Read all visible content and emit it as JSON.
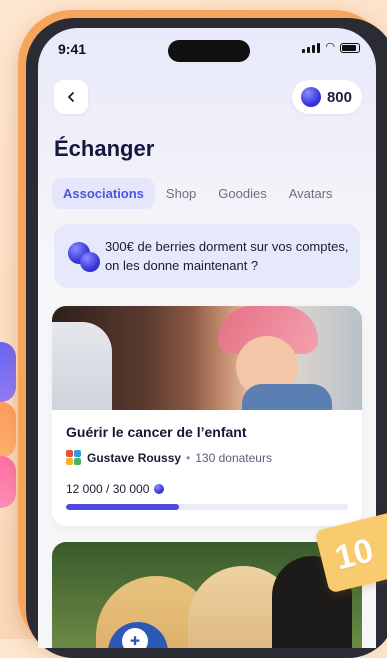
{
  "status_bar": {
    "time": "9:41"
  },
  "header": {
    "title": "Échanger",
    "coins": "800"
  },
  "tabs": [
    {
      "label": "Associations",
      "active": true
    },
    {
      "label": "Shop",
      "active": false
    },
    {
      "label": "Goodies",
      "active": false
    },
    {
      "label": "Avatars",
      "active": false
    }
  ],
  "banner": {
    "text": "300€ de berries dorment sur vos comptes, on les donne maintenant ?"
  },
  "cards": [
    {
      "title": "Guérir le cancer de l’enfant",
      "organization": "Gustave Roussy",
      "separator": "•",
      "donors": "130 donateurs",
      "progress_text": "12 000 / 30 000",
      "progress_fraction": 0.4
    }
  ],
  "ticket": {
    "text": "10"
  },
  "colors": {
    "accent": "#4d49e0",
    "tab_active_bg": "#e5e6fb",
    "frame": "#f7a45c"
  }
}
